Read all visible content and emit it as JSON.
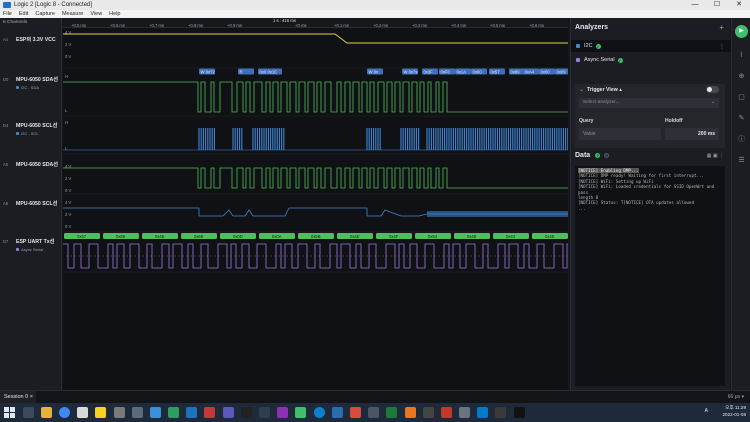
{
  "window": {
    "title": "Logic 2 [Logic 8 - Connected]",
    "controls": [
      "—",
      "☐",
      "✕"
    ]
  },
  "menu": [
    "File",
    "Edit",
    "Capture",
    "Measure",
    "View",
    "Help"
  ],
  "left_panel": {
    "channel_count": "6 Channels",
    "channels": [
      {
        "id": "A4",
        "name": "ESP의 3.3V VCC",
        "sub": "",
        "color": "#e0d24a"
      },
      {
        "id": "D0",
        "name": "MPU-6050 SDA선",
        "sub": "I2C - SDA",
        "color": "#4fbf5b"
      },
      {
        "id": "D4",
        "name": "MPU-6050 SCL선",
        "sub": "I2C - SCL",
        "color": "#3f86d6"
      },
      {
        "id": "A5",
        "name": "MPU-6050 SDA선",
        "sub": "",
        "color": "#4fbf5b"
      },
      {
        "id": "A6",
        "name": "MPU-6050 SCL선",
        "sub": "",
        "color": "#3f86d6"
      },
      {
        "id": "D7",
        "name": "ESP UART Tx선",
        "sub": "Async Serial",
        "color": "#9b7be0"
      }
    ]
  },
  "timescale": {
    "cursor": "1 s : 416 ms",
    "ticks": [
      "+0.5 ms",
      "+0.6 ms",
      "+0.7 ms",
      "+0.8 ms",
      "+0.9 ms",
      "+0 ms",
      "+0.1 ms",
      "+0.2 ms",
      "+0.3 ms",
      "+0.4 ms",
      "+0.5 ms",
      "+0.6 ms"
    ]
  },
  "waveforms": {
    "vcc_labels": [
      "4 V",
      "2 V",
      "0 V"
    ],
    "digital_labels": [
      "H",
      "L"
    ],
    "analog_labels": [
      "4 V",
      "2 V",
      "0 V"
    ],
    "i2c_frames": [
      "W 0x?2",
      "R",
      "0x00",
      "0x1C",
      "W 0x",
      "W 0x7s",
      "0x3F",
      "0xF0",
      "0x1A",
      "0x00",
      "0x57",
      "0x89",
      "0xA4",
      "0x00",
      "0x09",
      "0x04"
    ],
    "uart_frames": [
      "0x57",
      "0x69",
      "0x46",
      "0x69",
      "0x0D",
      "0x0A",
      "0x5B",
      "0x4E",
      "0x4F",
      "0x54",
      "0x49",
      "0x43",
      "0x45"
    ]
  },
  "right_panel": {
    "title": "Analyzers",
    "analyzers": [
      {
        "name": "I2C",
        "color": "#3f86d6"
      },
      {
        "name": "Async Serial",
        "color": "#9b7be0"
      }
    ],
    "trigger_view": "Trigger View ▴",
    "select_placeholder": "Select analyzer...",
    "query_label": "Query",
    "holdoff_label": "Holdoff",
    "value_placeholder": "Value",
    "holdoff_value": "200 ms",
    "data_title": "Data",
    "terminal_lines": [
      "[NOTICE] Enabling DMP...",
      "[NOTICE] DMP ready! Waiting for first interrupt...",
      "[NOTICE] WiFi: Setting up WiFi",
      "[NOTICE] WiFi: Loaded credentials for SSID OpenWrt and pass",
      "length 8",
      "[NOTICE] Status: T[NOTICE] OTA updates allowed",
      "..."
    ]
  },
  "session": {
    "tab_label": "Session 0",
    "sample_info": "66 μs ▾"
  },
  "taskbar": {
    "lang": "A",
    "time": "오후 11:29",
    "date": "2022-01-08"
  },
  "colors": {
    "accent_green": "#3fbf6b",
    "sda": "#4fbf5b",
    "scl": "#3f86d6",
    "uart": "#9b7be0",
    "vcc": "#e0d24a"
  }
}
